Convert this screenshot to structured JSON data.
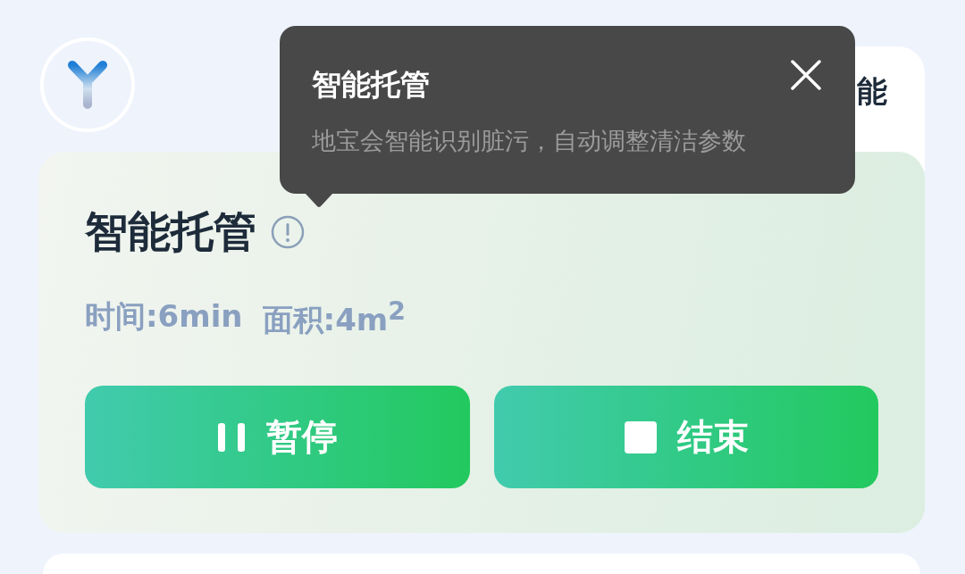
{
  "header": {
    "tab_label": "能"
  },
  "tooltip": {
    "title": "智能托管",
    "description": "地宝会智能识别脏污，自动调整清洁参数"
  },
  "mode_card": {
    "title": "智能托管",
    "stats": [
      "时间:6min",
      "面积:4m$^{2}$"
    ],
    "buttons": [
      {
        "kind": "pause",
        "label": "暂停"
      },
      {
        "kind": "stop",
        "label": "结束"
      }
    ]
  }
}
